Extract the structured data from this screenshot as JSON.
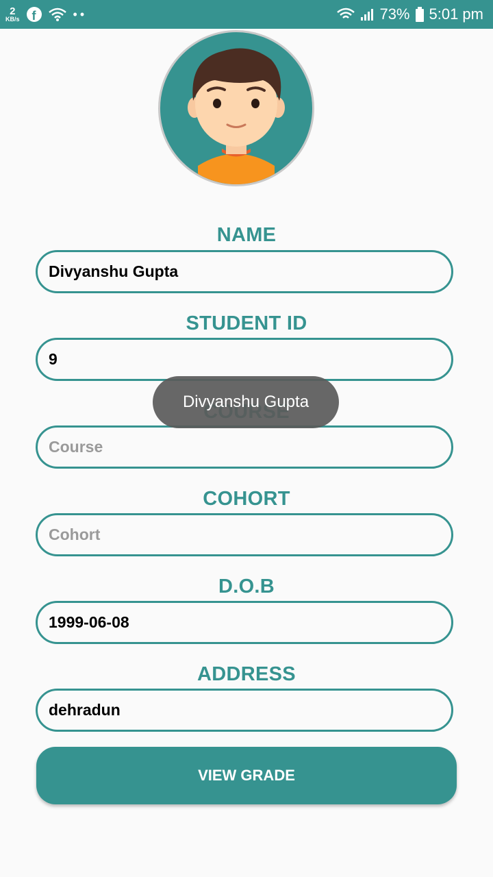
{
  "status_bar": {
    "data_rate_value": "2",
    "data_rate_unit": "KB/s",
    "battery": "73%",
    "time": "5:01 pm"
  },
  "form": {
    "name": {
      "label": "NAME",
      "value": "Divyanshu Gupta"
    },
    "student_id": {
      "label": "STUDENT ID",
      "value": "9"
    },
    "course": {
      "label": "COURSE",
      "placeholder": "Course"
    },
    "cohort": {
      "label": "COHORT",
      "placeholder": "Cohort"
    },
    "dob": {
      "label": "D.O.B",
      "value": "1999-06-08"
    },
    "address": {
      "label": "ADDRESS",
      "value": "dehradun"
    }
  },
  "button": {
    "label": "VIEW GRADE"
  },
  "toast": {
    "text": "Divyanshu Gupta"
  },
  "colors": {
    "accent": "#369390"
  }
}
